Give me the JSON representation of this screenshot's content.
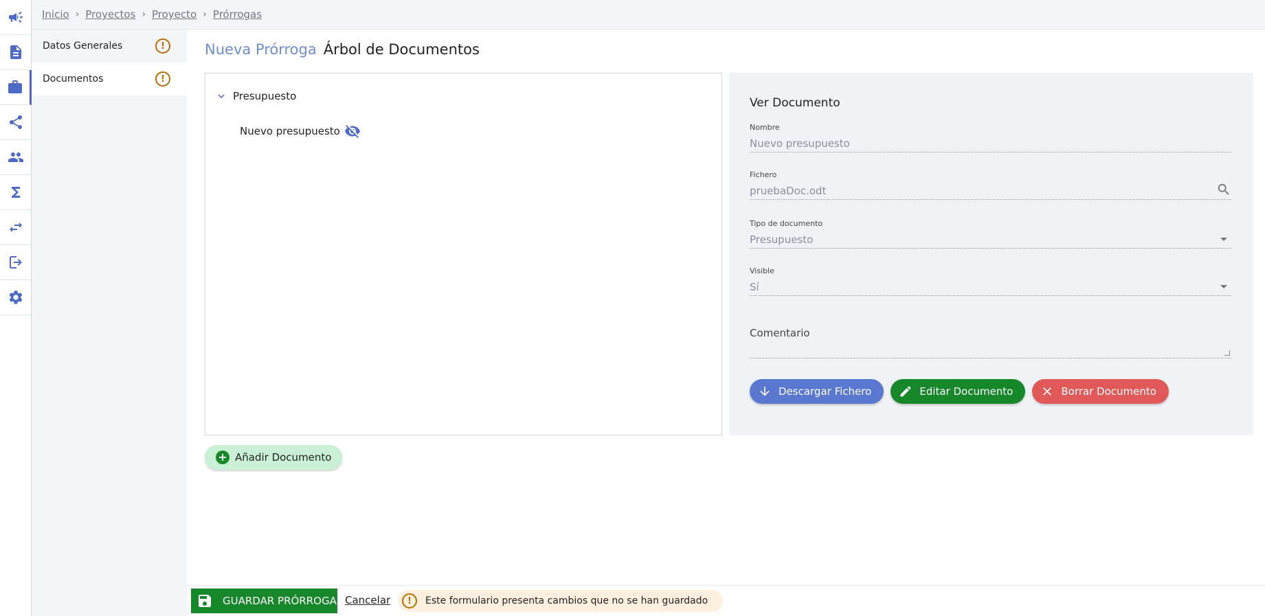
{
  "rail": {
    "items": [
      {
        "icon": "megaphone-icon"
      },
      {
        "icon": "document-icon"
      },
      {
        "icon": "briefcase-icon"
      },
      {
        "icon": "share-icon"
      },
      {
        "icon": "people-icon"
      },
      {
        "icon": "sigma-icon"
      },
      {
        "icon": "swap-arrows-icon"
      },
      {
        "icon": "logout-icon"
      },
      {
        "icon": "gear-icon"
      }
    ]
  },
  "breadcrumb": {
    "items": [
      "Inicio",
      "Proyectos",
      "Proyecto",
      "Prórrogas"
    ]
  },
  "sidebar": {
    "items": [
      {
        "label": "Datos Generales",
        "warning": "!"
      },
      {
        "label": "Documentos",
        "warning": "!"
      }
    ]
  },
  "page": {
    "title_accent": "Nueva Prórroga",
    "title_main": "Árbol de Documentos"
  },
  "tree": {
    "parent_label": "Presupuesto",
    "child_label": "Nuevo presupuesto"
  },
  "detail": {
    "title": "Ver Documento",
    "fields": {
      "nombre_label": "Nombre",
      "nombre_value": "Nuevo presupuesto",
      "fichero_label": "Fichero",
      "fichero_value": "pruebaDoc.odt",
      "tipo_label": "Tipo de documento",
      "tipo_value": "Presupuesto",
      "visible_label": "Visible",
      "visible_value": "Sí",
      "comentario_label": "Comentario"
    },
    "buttons": {
      "download": "Descargar Fichero",
      "edit": "Editar Documento",
      "delete": "Borrar Documento"
    }
  },
  "add_document_label": "Añadir Documento",
  "footer": {
    "save_label": "GUARDAR PRÓRROGA",
    "cancel_label": "Cancelar",
    "alert_icon": "!",
    "alert_text": "Este formulario presenta cambios que no se han guardado"
  },
  "colors": {
    "accent": "#4d6bc6",
    "success": "#17882a",
    "danger": "#e05858",
    "warning": "#b86d00"
  }
}
